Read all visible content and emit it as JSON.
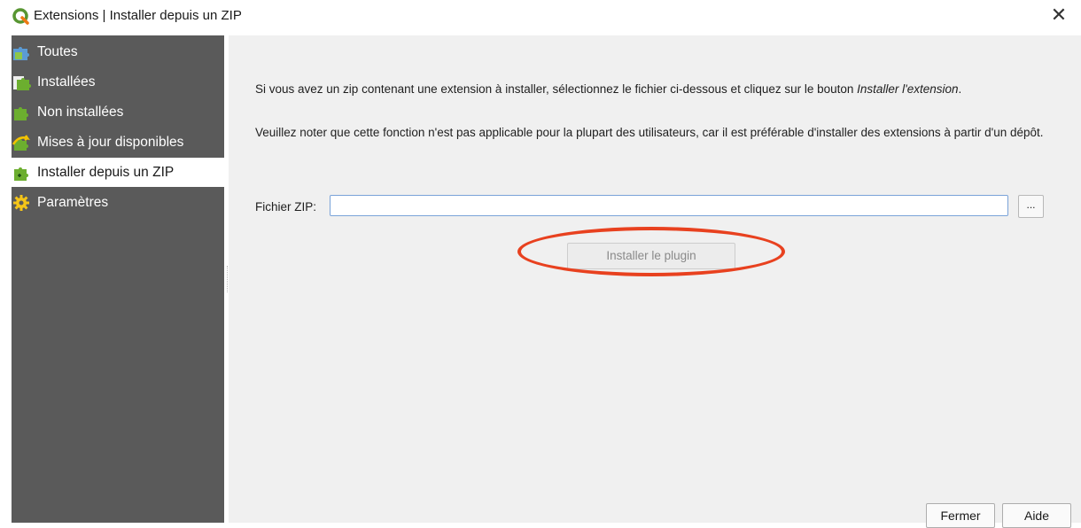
{
  "window": {
    "title": "Extensions | Installer depuis un ZIP",
    "app_icon": "qgis-logo-icon",
    "close_glyph": "✕",
    "accent_color": "#e8411f"
  },
  "sidebar": {
    "items": [
      {
        "label": "Toutes",
        "icon": "puzzle-all-icon"
      },
      {
        "label": "Installées",
        "icon": "puzzle-installed-icon"
      },
      {
        "label": "Non installées",
        "icon": "puzzle-not-installed-icon"
      },
      {
        "label": "Mises à jour disponibles",
        "icon": "puzzle-update-icon"
      },
      {
        "label": "Installer depuis un ZIP",
        "icon": "puzzle-zip-icon",
        "selected": true
      },
      {
        "label": "Paramètres",
        "icon": "gear-icon"
      }
    ]
  },
  "main": {
    "para1_text": "Si vous avez un zip contenant une extension à installer, sélectionnez le fichier ci-dessous et cliquez sur le bouton ",
    "para1_emph": "Installer l'extension",
    "para1_end": ".",
    "para2_text": "Veuillez noter que cette fonction n'est pas applicable pour la plupart des utilisateurs, car il est préférable d'installer des extensions à partir d'un dépôt.",
    "zip_label": "Fichier ZIP:",
    "zip_value": "",
    "browse_label": "...",
    "install_button": "Installer le plugin"
  },
  "footer": {
    "close_button": "Fermer",
    "help_button": "Aide"
  }
}
